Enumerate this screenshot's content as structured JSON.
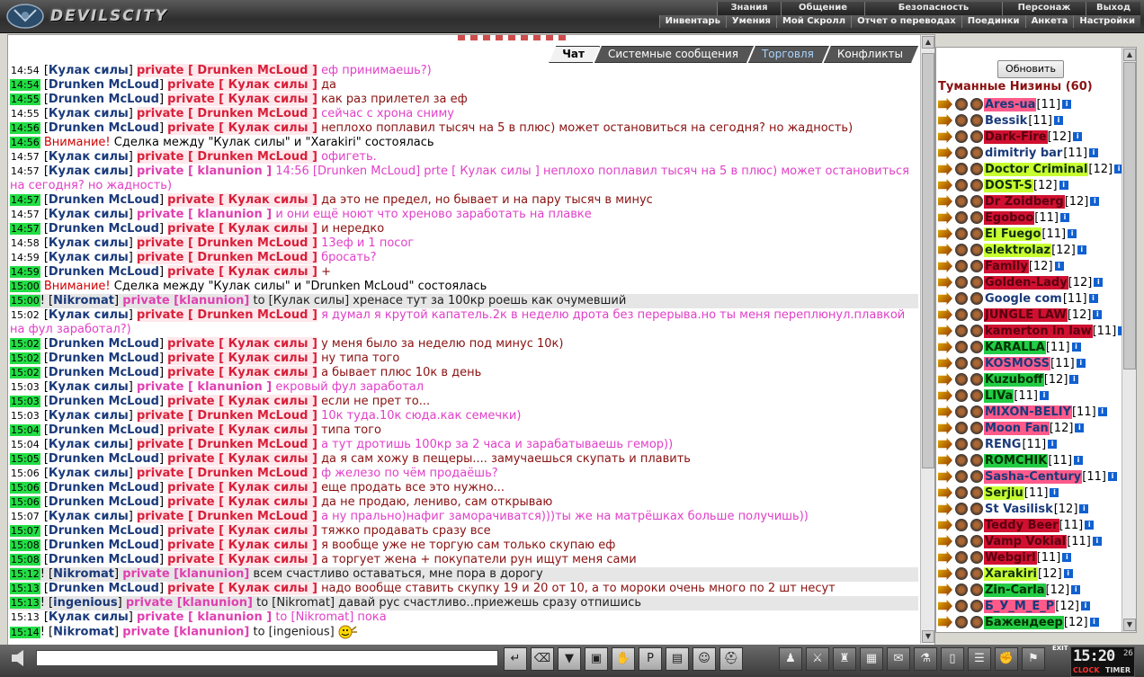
{
  "header": {
    "logo_text": "DEVILSCITY",
    "menu_top": [
      "Знания",
      "Общение",
      "Безопасность",
      "Персонаж",
      "Выход"
    ],
    "menu_bottom": [
      "Инвентарь",
      "Умения",
      "Мой Скролл",
      "Отчет о переводах",
      "Поединки",
      "Анкета",
      "Настройки"
    ]
  },
  "tabs": [
    "Чат",
    "Системные сообщения",
    "Торговля",
    "Конфликты"
  ],
  "chat": [
    {
      "time": "14:54",
      "hl": false,
      "who": "Кулак силы",
      "priv": "private [ Drunken McLoud ]",
      "text": "еф принимаешь?)",
      "tc": "pink"
    },
    {
      "time": "14:54",
      "hl": true,
      "who": "Drunken McLoud",
      "priv": "private [ Кулак силы ]",
      "text": "да",
      "tc": "red"
    },
    {
      "time": "14:55",
      "hl": true,
      "who": "Drunken McLoud",
      "priv": "private [ Кулак силы ]",
      "text": "как раз прилетел за еф",
      "tc": "red"
    },
    {
      "time": "14:55",
      "hl": false,
      "who": "Кулак силы",
      "priv": "private [ Drunken McLoud ]",
      "text": "сейчас с хрона сниму",
      "tc": "pink"
    },
    {
      "time": "14:56",
      "hl": true,
      "who": "Drunken McLoud",
      "priv": "private [ Кулак силы ]",
      "text": "неплохо поплавил тысяч на 5 в плюс) может остановиться на сегодня? но жадность)",
      "tc": "red"
    },
    {
      "time": "14:56",
      "hl": true,
      "warn": "Внимание!",
      "text": "Сделка между \"Кулак силы\" и \"Xarakiri\" состоялась"
    },
    {
      "time": "14:57",
      "hl": false,
      "who": "Кулак силы",
      "priv": "private [ Drunken McLoud ]",
      "text": "офигеть.",
      "tc": "pink"
    },
    {
      "time": "14:57",
      "hl": false,
      "who": "Кулак силы",
      "priv": "private [ klanunion ]",
      "text": "14:56 [Drunken McLoud] prte [ Кулак силы ] неплохо поплавил тысяч на 5 в плюс) может остановиться на сегодня? но жадность)",
      "tc": "pink",
      "pc": "pink"
    },
    {
      "time": "14:57",
      "hl": true,
      "who": "Drunken McLoud",
      "priv": "private [ Кулак силы ]",
      "text": "да это не предел, но бывает и на пару тысяч в минус",
      "tc": "red"
    },
    {
      "time": "14:57",
      "hl": false,
      "who": "Кулак силы",
      "priv": "private [ klanunion ]",
      "text": "и они ещё ноют что хреново заработать на плавке",
      "tc": "pink",
      "pc": "pink"
    },
    {
      "time": "14:57",
      "hl": true,
      "who": "Drunken McLoud",
      "priv": "private [ Кулак силы ]",
      "text": "и нередко",
      "tc": "red"
    },
    {
      "time": "14:58",
      "hl": false,
      "who": "Кулак силы",
      "priv": "private [ Drunken McLoud ]",
      "text": "13еф и 1 посог",
      "tc": "pink"
    },
    {
      "time": "14:59",
      "hl": false,
      "who": "Кулак силы",
      "priv": "private [ Drunken McLoud ]",
      "text": "бросать?",
      "tc": "pink"
    },
    {
      "time": "14:59",
      "hl": true,
      "who": "Drunken McLoud",
      "priv": "private [ Кулак силы ]",
      "text": "+",
      "tc": "red"
    },
    {
      "time": "15:00",
      "hl": true,
      "warn": "Внимание!",
      "text": "Сделка между \"Кулак силы\" и \"Drunken McLoud\" состоялась"
    },
    {
      "time": "15:00",
      "hl": true,
      "bang": true,
      "who": "Nikromat",
      "priv": "private [klanunion]",
      "text": "to [Кулак силы] хренасе тут за 100кр роешь как очумевший",
      "tc": "dark",
      "pc": "pink",
      "row": true
    },
    {
      "time": "15:02",
      "hl": false,
      "who": "Кулак силы",
      "priv": "private [ Drunken McLoud ]",
      "text": "я думал я крутой капатель.2к в неделю дрота без перерыва.но ты меня переплюнул.плавкой на фул заработал?)",
      "tc": "pink"
    },
    {
      "time": "15:02",
      "hl": true,
      "who": "Drunken McLoud",
      "priv": "private [ Кулак силы ]",
      "text": "у меня было за неделю под минус 10к)",
      "tc": "red"
    },
    {
      "time": "15:02",
      "hl": true,
      "who": "Drunken McLoud",
      "priv": "private [ Кулак силы ]",
      "text": "ну типа того",
      "tc": "red"
    },
    {
      "time": "15:02",
      "hl": true,
      "who": "Drunken McLoud",
      "priv": "private [ Кулак силы ]",
      "text": "а бывает плюс 10к в день",
      "tc": "red"
    },
    {
      "time": "15:03",
      "hl": false,
      "who": "Кулак силы",
      "priv": "private [ klanunion ]",
      "text": "екровый фул заработал",
      "tc": "pink",
      "pc": "pink"
    },
    {
      "time": "15:03",
      "hl": true,
      "who": "Drunken McLoud",
      "priv": "private [ Кулак силы ]",
      "text": "если не прет то...",
      "tc": "red"
    },
    {
      "time": "15:03",
      "hl": false,
      "who": "Кулак силы",
      "priv": "private [ Drunken McLoud ]",
      "text": "10к туда.10к сюда.как семечки)",
      "tc": "pink"
    },
    {
      "time": "15:04",
      "hl": true,
      "who": "Drunken McLoud",
      "priv": "private [ Кулак силы ]",
      "text": "типа того",
      "tc": "red"
    },
    {
      "time": "15:04",
      "hl": false,
      "who": "Кулак силы",
      "priv": "private [ Drunken McLoud ]",
      "text": "а тут дротишь 100кр за 2 часа и зарабатываешь гемор))",
      "tc": "pink"
    },
    {
      "time": "15:05",
      "hl": true,
      "who": "Drunken McLoud",
      "priv": "private [ Кулак силы ]",
      "text": "да я сам хожу в пещеры.... замучаешься скупать и плавить",
      "tc": "red"
    },
    {
      "time": "15:06",
      "hl": false,
      "who": "Кулак силы",
      "priv": "private [ Drunken McLoud ]",
      "text": "ф железо по чём продаёшь?",
      "tc": "pink"
    },
    {
      "time": "15:06",
      "hl": true,
      "who": "Drunken McLoud",
      "priv": "private [ Кулак силы ]",
      "text": "еще продать все это нужно...",
      "tc": "red"
    },
    {
      "time": "15:06",
      "hl": true,
      "who": "Drunken McLoud",
      "priv": "private [ Кулак силы ]",
      "text": "да не продаю, лениво, сам открываю",
      "tc": "red"
    },
    {
      "time": "15:07",
      "hl": false,
      "who": "Кулак силы",
      "priv": "private [ Drunken McLoud ]",
      "text": "а ну прально)нафиг заморачиватся)))ты же на матрёшках больше получишь))",
      "tc": "pink"
    },
    {
      "time": "15:07",
      "hl": true,
      "who": "Drunken McLoud",
      "priv": "private [ Кулак силы ]",
      "text": "тяжко продавать сразу все",
      "tc": "red"
    },
    {
      "time": "15:08",
      "hl": true,
      "who": "Drunken McLoud",
      "priv": "private [ Кулак силы ]",
      "text": "я вообще уже не торгую сам только скупаю еф",
      "tc": "red"
    },
    {
      "time": "15:08",
      "hl": true,
      "who": "Drunken McLoud",
      "priv": "private [ Кулак силы ]",
      "text": "а торгует жена + покупатели рун ищут меня сами",
      "tc": "red"
    },
    {
      "time": "15:12",
      "hl": true,
      "bang": true,
      "who": "Nikromat",
      "priv": "private [klanunion]",
      "text": "всем счастливо оставаться, мне пора в дорогу",
      "tc": "dark",
      "pc": "pink",
      "row": true
    },
    {
      "time": "15:13",
      "hl": true,
      "who": "Drunken McLoud",
      "priv": "private [ Кулак силы ]",
      "text": "надо вообще ставить скупку 19 и 20 от 10, а то мороки очень много по 2 шт несут",
      "tc": "red"
    },
    {
      "time": "15:13",
      "hl": true,
      "bang": true,
      "who": "ingenious",
      "priv": "private [klanunion]",
      "text": "to [Nikromat] давай рус счастливо..приежешь сразу отпишись",
      "tc": "dark",
      "pc": "pink",
      "row": true
    },
    {
      "time": "15:13",
      "hl": false,
      "who": "Кулак силы",
      "priv": "private [ klanunion ]",
      "text": "to [Nikromat] пока",
      "tc": "pink",
      "pc": "pink"
    },
    {
      "time": "15:14",
      "hl": true,
      "bang": true,
      "who": "Nikromat",
      "priv": "private [klanunion]",
      "text": "to [ingenious]",
      "tc": "dark",
      "pc": "pink",
      "smile": true
    }
  ],
  "right_panel": {
    "refresh_label": "Обновить",
    "location": "Туманные Низины (60)",
    "users": [
      {
        "name": "Ares-ua",
        "lvl": "[11]",
        "c": "pink"
      },
      {
        "name": "Bessik",
        "lvl": "[11]",
        "c": ""
      },
      {
        "name": "Dark-Fire",
        "lvl": "[12]",
        "c": "red"
      },
      {
        "name": "dimitriy bar",
        "lvl": "[11]",
        "c": ""
      },
      {
        "name": "Doctor Criminal",
        "lvl": "[12]",
        "c": "yellow"
      },
      {
        "name": "DOST-S",
        "lvl": "[12]",
        "c": "yellow"
      },
      {
        "name": "Dr Zoidberg",
        "lvl": "[12]",
        "c": "red"
      },
      {
        "name": "Egoboo",
        "lvl": "[11]",
        "c": "red"
      },
      {
        "name": "El Fuego",
        "lvl": "[11]",
        "c": "yellow"
      },
      {
        "name": "elektrolaz",
        "lvl": "[12]",
        "c": "yellow"
      },
      {
        "name": "Family",
        "lvl": "[12]",
        "c": "red"
      },
      {
        "name": "Golden-Lady",
        "lvl": "[12]",
        "c": "red"
      },
      {
        "name": "Google com",
        "lvl": "[11]",
        "c": ""
      },
      {
        "name": "JUNGLE LAW",
        "lvl": "[12]",
        "c": "red"
      },
      {
        "name": "kamerton in law",
        "lvl": "[11]",
        "c": "red"
      },
      {
        "name": "KARALLA",
        "lvl": "[11]",
        "c": "green"
      },
      {
        "name": "KOSMOSS",
        "lvl": "[11]",
        "c": "pink"
      },
      {
        "name": "Kuzuboff",
        "lvl": "[12]",
        "c": "green"
      },
      {
        "name": "LIVa",
        "lvl": "[11]",
        "c": "green"
      },
      {
        "name": "MIXON-BELIY",
        "lvl": "[11]",
        "c": "pink"
      },
      {
        "name": "Moon Fan",
        "lvl": "[12]",
        "c": "pink"
      },
      {
        "name": "RENG",
        "lvl": "[11]",
        "c": ""
      },
      {
        "name": "ROMCHIK",
        "lvl": "[11]",
        "c": "green"
      },
      {
        "name": "Sasha-Century",
        "lvl": "[11]",
        "c": "pink"
      },
      {
        "name": "Serjiu",
        "lvl": "[11]",
        "c": "yellow"
      },
      {
        "name": "St Vasilisk",
        "lvl": "[12]",
        "c": ""
      },
      {
        "name": "Teddy Beer",
        "lvl": "[11]",
        "c": "red"
      },
      {
        "name": "Vamp Vokial",
        "lvl": "[11]",
        "c": "red"
      },
      {
        "name": "Webgirl",
        "lvl": "[11]",
        "c": "red"
      },
      {
        "name": "Xarakiri",
        "lvl": "[12]",
        "c": "yellow"
      },
      {
        "name": "Zin-Carla",
        "lvl": "[12]",
        "c": "green"
      },
      {
        "name": "Б_У_М_Е_Р",
        "lvl": "[12]",
        "c": "pink"
      },
      {
        "name": "Бажендеер",
        "lvl": "[12]",
        "c": "green"
      }
    ]
  },
  "toolbar": {
    "input_value": "",
    "icons": [
      "enter-icon",
      "eraser-icon",
      "filter-icon",
      "save-icon",
      "smiles-icon",
      "translit-icon",
      "log-icon",
      "smile-icon",
      "helmet-icon",
      "user-icon",
      "fight-icon",
      "bag-icon",
      "chest-icon",
      "scroll-icon",
      "potion-icon",
      "door-icon",
      "book-icon",
      "fist-icon",
      "flag-icon"
    ],
    "exit_label": "EXIT",
    "clock_time": "15:20",
    "clock_sec": "26",
    "clock_label": "CLOCK",
    "timer_label": "TIMER"
  }
}
